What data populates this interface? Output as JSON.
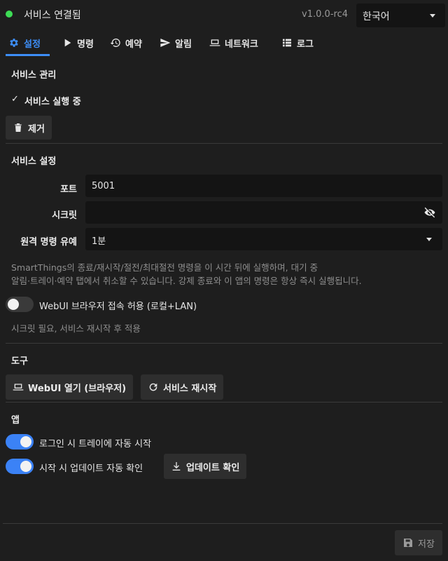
{
  "header": {
    "status_text": "서비스 연결됨",
    "status_color": "#3ddc55",
    "version": "v1.0.0-rc4",
    "language": "한국어"
  },
  "tabs": [
    {
      "label": "설정",
      "icon": "gear-icon",
      "active": true
    },
    {
      "label": "명령",
      "icon": "play-icon",
      "active": false
    },
    {
      "label": "예약",
      "icon": "history-icon",
      "active": false
    },
    {
      "label": "알림",
      "icon": "send-icon",
      "active": false
    },
    {
      "label": "네트워크",
      "icon": "laptop-icon",
      "active": false
    },
    {
      "label": "로그",
      "icon": "list-icon",
      "active": false
    }
  ],
  "service_management": {
    "title": "서비스 관리",
    "check_mark": "✓",
    "running_status": "서비스 실행 중",
    "remove_button": "제거"
  },
  "service_settings": {
    "title": "서비스 설정",
    "port_label": "포트",
    "port_value": "5001",
    "secret_label": "시크릿",
    "secret_value": "",
    "grace_label": "원격 명령 유예",
    "grace_value": "1분",
    "hint_line1": "SmartThings의 종료/재시작/절전/최대절전 명령을 이 시간 뒤에 실행하며, 대기 중",
    "hint_line2": "알림·트레이·예약 탭에서 취소할 수 있습니다. 강제 종료와 이 앱의 명령은 항상 즉시 실행됩니다.",
    "webui_toggle_label": "WebUI 브라우저 접속 허용 (로컬+LAN)",
    "webui_toggle_on": false,
    "webui_hint": "시크릿 필요, 서비스 재시작 후 적용"
  },
  "tools": {
    "title": "도구",
    "open_webui_button": "WebUI 열기 (브라우저)",
    "restart_service_button": "서비스 재시작"
  },
  "app": {
    "title": "앱",
    "autostart_label": "로그인 시 트레이에 자동 시작",
    "autostart_on": true,
    "update_check_label": "시작 시 업데이트 자동 확인",
    "update_check_on": true,
    "check_update_button": "업데이트 확인"
  },
  "footer": {
    "save_button": "저장"
  },
  "colors": {
    "accent": "#3d8ef7",
    "background": "#1e1e1e",
    "input_bg": "#141414"
  }
}
